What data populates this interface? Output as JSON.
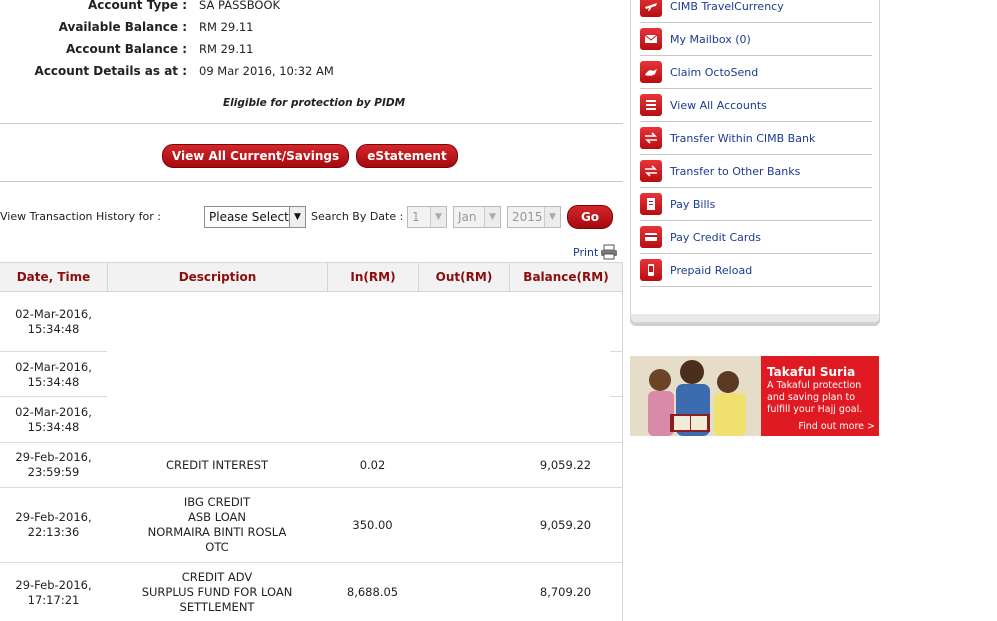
{
  "account": {
    "rows": [
      {
        "label": "Account Type :",
        "value": "SA PASSBOOK"
      },
      {
        "label": "Available Balance :",
        "value": "RM 29.11"
      },
      {
        "label": "Account Balance :",
        "value": "RM 29.11"
      },
      {
        "label": "Account Details as at :",
        "value": "09 Mar 2016, 10:32 AM"
      }
    ],
    "pidm_note": "Eligible for protection by PIDM"
  },
  "buttons": {
    "view_all": "View All Current/Savings",
    "estatement": "eStatement",
    "go": "Go"
  },
  "filter": {
    "view_history_label": "View Transaction History for :",
    "select_value": "Please Select",
    "search_by_date_label": "Search By Date :",
    "day": "1",
    "month": "Jan",
    "year": "2015"
  },
  "print_label": "Print",
  "table": {
    "headers": [
      "Date, Time",
      "Description",
      "In(RM)",
      "Out(RM)",
      "Balance(RM)"
    ],
    "rows": [
      {
        "date": "02-Mar-2016,",
        "time": "15:34:48",
        "desc": [],
        "in": "",
        "out": "",
        "balance": ""
      },
      {
        "date": "02-Mar-2016,",
        "time": "15:34:48",
        "desc": [],
        "in": "",
        "out": "",
        "balance": ""
      },
      {
        "date": "02-Mar-2016,",
        "time": "15:34:48",
        "desc": [],
        "in": "",
        "out": "",
        "balance": ""
      },
      {
        "date": "29-Feb-2016,",
        "time": "23:59:59",
        "desc": [
          "CREDIT INTEREST"
        ],
        "in": "0.02",
        "out": "",
        "balance": "9,059.22"
      },
      {
        "date": "29-Feb-2016,",
        "time": "22:13:36",
        "desc": [
          "IBG CREDIT",
          "ASB LOAN",
          "NORMAIRA BINTI ROSLA",
          "OTC"
        ],
        "in": "350.00",
        "out": "",
        "balance": "9,059.20"
      },
      {
        "date": "29-Feb-2016,",
        "time": "17:17:21",
        "desc": [
          "CREDIT ADV",
          "SURPLUS FUND FOR LOAN",
          "SETTLEMENT"
        ],
        "in": "8,688.05",
        "out": "",
        "balance": "8,709.20"
      }
    ]
  },
  "quick_links": [
    {
      "label": "CIMB TravelCurrency",
      "icon": "travel-currency-icon"
    },
    {
      "label": "My Mailbox  (0)",
      "icon": "mailbox-icon"
    },
    {
      "label": "Claim OctoSend",
      "icon": "octosend-icon"
    },
    {
      "label": "View All Accounts",
      "icon": "list-icon"
    },
    {
      "label": "Transfer Within CIMB Bank",
      "icon": "transfer-within-icon"
    },
    {
      "label": "Transfer to Other Banks",
      "icon": "transfer-other-icon"
    },
    {
      "label": "Pay Bills",
      "icon": "bills-icon"
    },
    {
      "label": "Pay Credit Cards",
      "icon": "credit-card-icon"
    },
    {
      "label": "Prepaid Reload",
      "icon": "reload-icon"
    }
  ],
  "banner": {
    "title": "Takaful Suria",
    "text": "A Takaful protection and saving plan to fulfill your Hajj goal.",
    "cta": "Find out more >"
  },
  "colors": {
    "brand_red": "#c0141a",
    "header_text": "#8b0d0d",
    "link_blue": "#1a3b8f"
  }
}
